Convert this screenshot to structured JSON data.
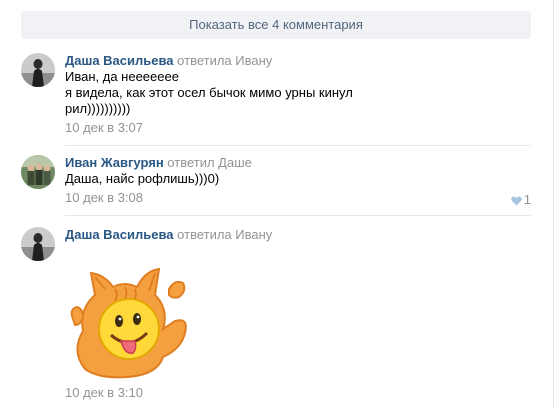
{
  "show_all_label": "Показать все 4 комментария",
  "comments": [
    {
      "author": "Даша Васильева",
      "reply_to": "ответила Ивану",
      "lines": [
        "Иван, да неееееее",
        "я видела, как этот осел бычок мимо урны кинул",
        "рил))))))))))"
      ],
      "date": "10 дек в 3:07"
    },
    {
      "author": "Иван Жавгурян",
      "reply_to": "ответил Даше",
      "lines": [
        "Даша, найс рофлишь)))0)"
      ],
      "date": "10 дек в 3:08",
      "likes": "1",
      "like_icon": "heart-icon"
    },
    {
      "author": "Даша Васильева",
      "reply_to": "ответила Ивану",
      "sticker": "cat-smiley-sticker",
      "date": "10 дек в 3:10"
    }
  ],
  "colors": {
    "author": "#2a5885",
    "muted": "#939393",
    "button_bg": "#f0f2f5",
    "button_text": "#55677d",
    "divider": "#e7e8ec",
    "like_heart": "#a8c4e0"
  }
}
